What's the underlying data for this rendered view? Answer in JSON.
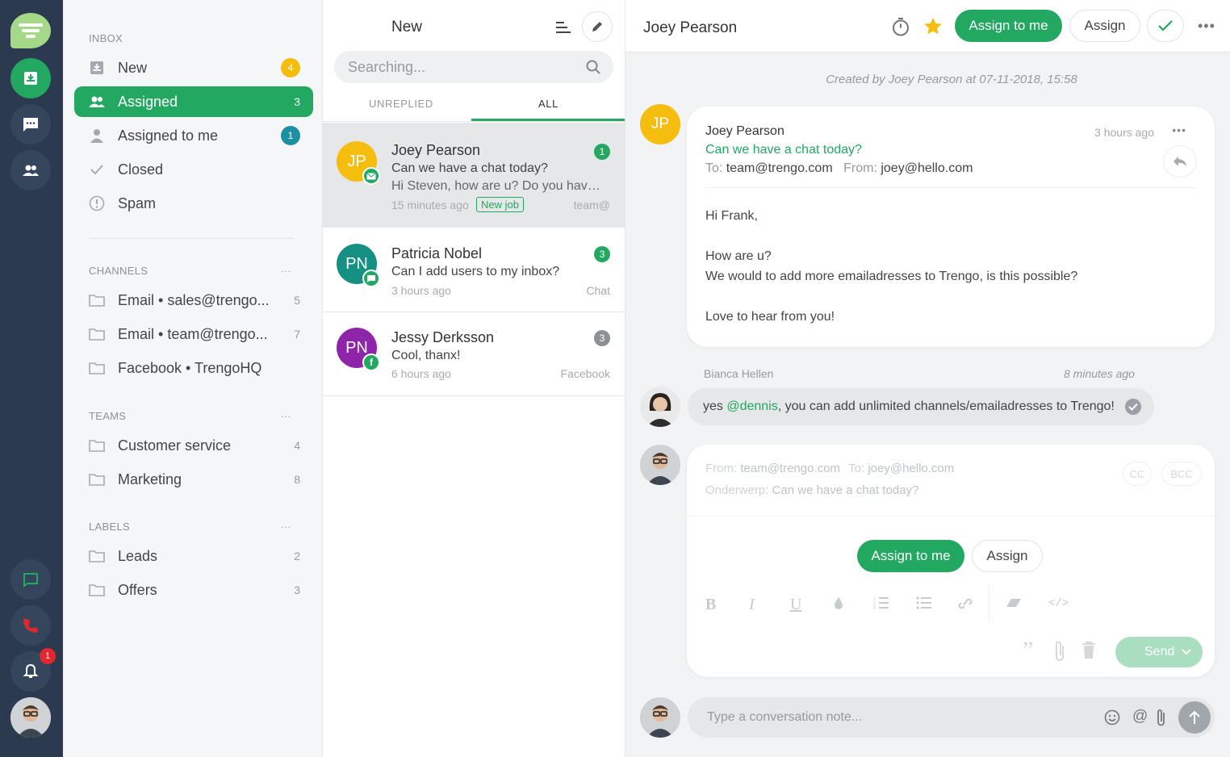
{
  "colors": {
    "accent": "#22a860",
    "rail": "#2b3a4e",
    "badge_yellow": "#f5bd0e",
    "badge_teal": "#1d8fa3",
    "badge_red": "#e4262f"
  },
  "rail": {
    "notification_count": "1"
  },
  "sidebar": {
    "inbox_title": "INBOX",
    "inbox": [
      {
        "label": "New",
        "count": "4",
        "icon": "inbox-icon"
      },
      {
        "label": "Assigned",
        "count": "3",
        "icon": "users-icon"
      },
      {
        "label": "Assigned to me",
        "count": "1",
        "icon": "user-icon"
      },
      {
        "label": "Closed",
        "icon": "check-icon"
      },
      {
        "label": "Spam",
        "icon": "alert-icon"
      }
    ],
    "channels_title": "CHANNELS",
    "channels": [
      {
        "label": "Email • sales@trengo...",
        "count": "5"
      },
      {
        "label": "Email • team@trengo...",
        "count": "7"
      },
      {
        "label": "Facebook • TrengoHQ",
        "count": ""
      }
    ],
    "teams_title": "TEAMS",
    "teams": [
      {
        "label": "Customer service",
        "count": "4"
      },
      {
        "label": "Marketing",
        "count": "8"
      }
    ],
    "labels_title": "LABELS",
    "labels": [
      {
        "label": "Leads",
        "count": "2"
      },
      {
        "label": "Offers",
        "count": "3"
      }
    ],
    "more": "..."
  },
  "list": {
    "title": "New",
    "search_placeholder": "Searching...",
    "tabs": [
      "UNREPLIED",
      "ALL"
    ],
    "conversations": [
      {
        "initials": "JP",
        "name": "Joey Pearson",
        "subject": "Can we have a chat today?",
        "preview": "Hi Steven, how are u? Do you have...",
        "time": "15 minutes ago",
        "tag": "New job",
        "channel": "team@",
        "count": "1"
      },
      {
        "initials": "PN",
        "name": "Patricia Nobel",
        "subject": "Can I add users to my inbox?",
        "time": "3 hours ago",
        "channel": "Chat",
        "count": "3"
      },
      {
        "initials": "PN",
        "name": "Jessy Derksson",
        "subject": "Cool, thanx!",
        "time": "6 hours ago",
        "channel": "Facebook",
        "count": "3"
      }
    ]
  },
  "main": {
    "title": "Joey Pearson",
    "assign_to_me": "Assign to me",
    "assign": "Assign",
    "created": "Created by Joey Pearson at 07-11-2018, 15:58",
    "message": {
      "initials": "JP",
      "from": "Joey Pearson",
      "time": "3 hours ago",
      "subject": "Can we have a chat today?",
      "to_label": "To:",
      "to": "team@trengo.com",
      "from_label": "From:",
      "from_email": "joey@hello.com",
      "body": [
        "Hi Frank,",
        "How are u?",
        "We would to add more emailadresses to Trengo, is this possible?",
        "Love to hear from you!"
      ]
    },
    "note": {
      "author": "Bianca Hellen",
      "time": "8 minutes ago",
      "prefix": "yes ",
      "mention": "@dennis",
      "suffix": ", you can add unlimited channels/emailadresses to Trengo!"
    },
    "reply": {
      "from_label": "From:",
      "from": "team@trengo.com",
      "to_label": "To:",
      "to": "joey@hello.com",
      "subject_label": "Onderwerp:",
      "subject": "Can we have a chat today?",
      "cc": "CC",
      "bcc": "BCC",
      "assign_to_me": "Assign to me",
      "assign": "Assign",
      "send": "Send"
    },
    "note_placeholder": "Type a conversation note..."
  }
}
